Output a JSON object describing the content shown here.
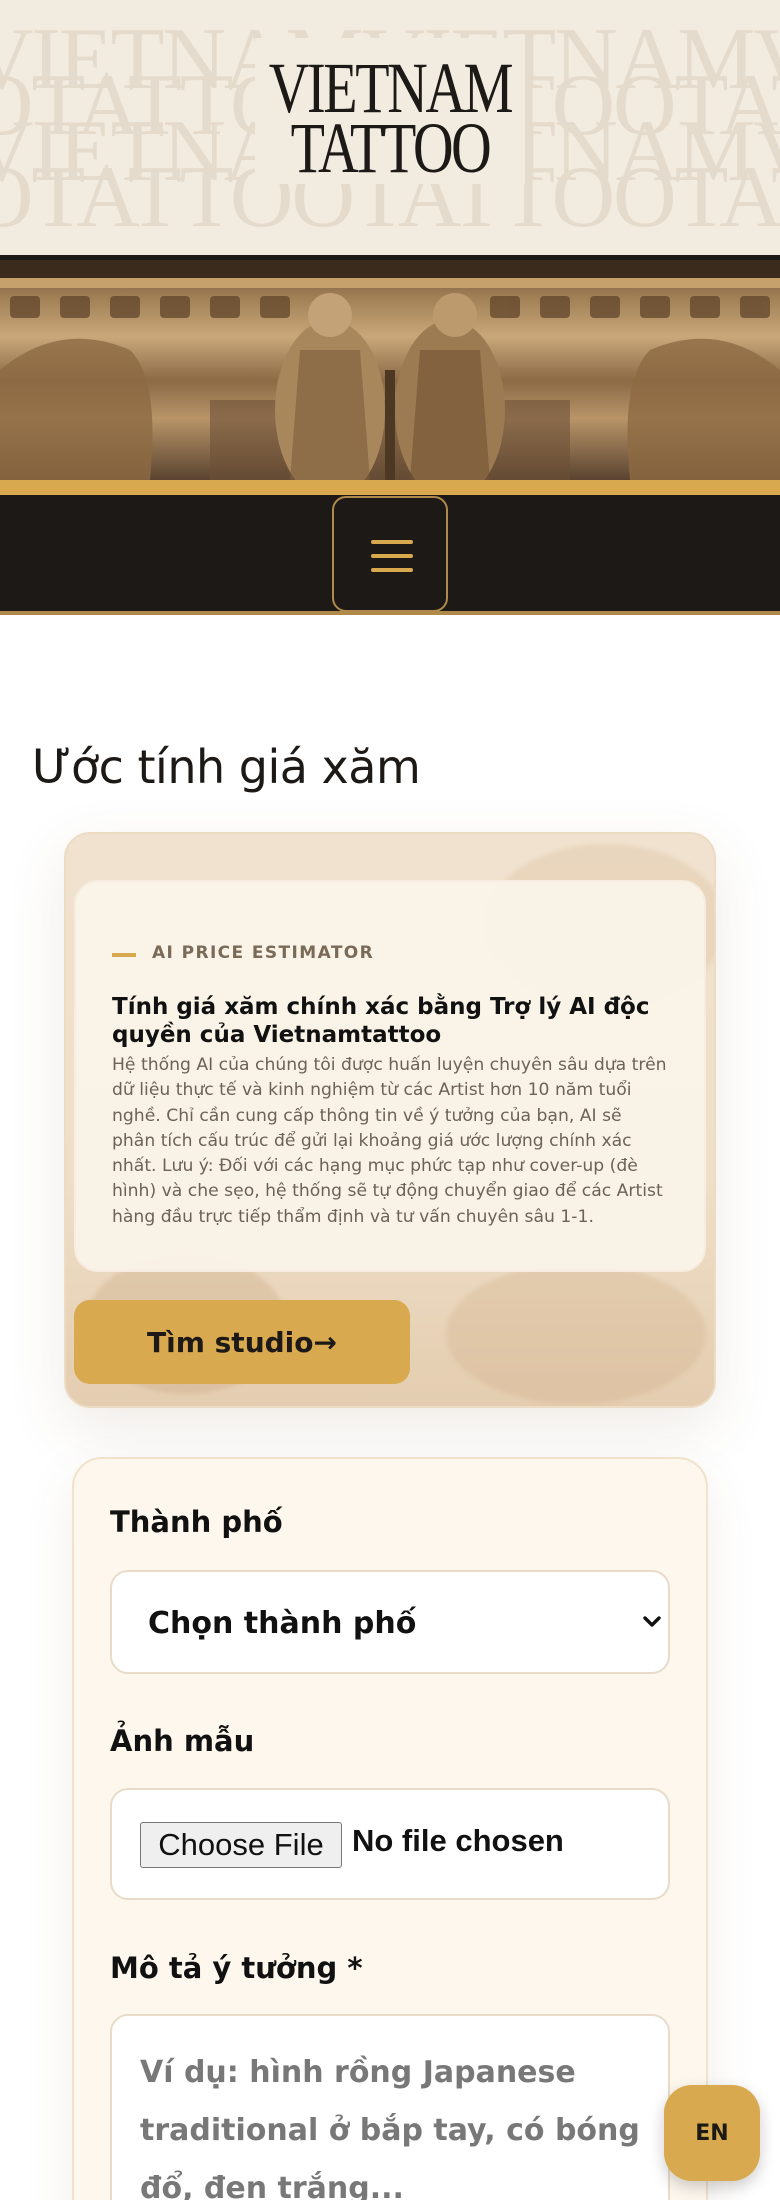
{
  "brand": {
    "logo_line1": "VIETNAM",
    "logo_line2": "TATTOO",
    "pattern_words": [
      "VIETNAMVIETNAMVIETNAMVIETNAMV",
      "OTATTOOTATTOOTATTOOTATT"
    ]
  },
  "nav": {
    "menu_icon": "hamburger-icon"
  },
  "page": {
    "title": "Ước tính giá xăm"
  },
  "estimator": {
    "kicker": "AI PRICE ESTIMATOR",
    "heading": "Tính giá xăm chính xác bằng Trợ lý AI độc quyền của Vietnamtattoo",
    "body": "Hệ thống AI của chúng tôi được huấn luyện chuyên sâu dựa trên dữ liệu thực tế và kinh nghiệm từ các Artist hơn 10 năm tuổi nghề. Chỉ cần cung cấp thông tin về ý tưởng của bạn, AI sẽ phân tích cấu trúc để gửi lại khoảng giá ước lượng chính xác nhất. Lưu ý: Đối với các hạng mục phức tạp như cover-up (đè hình) và che sẹo, hệ thống sẽ tự động chuyển giao để các Artist hàng đầu trực tiếp thẩm định và tư vấn chuyên sâu 1-1.",
    "cta_label": "Tìm studio→"
  },
  "form": {
    "city_label": "Thành phố",
    "city_value": "Chọn thành phố",
    "image_label": "Ảnh mẫu",
    "file_button": "Choose File",
    "file_status": "No file chosen",
    "idea_label": "Mô tả ý tưởng *",
    "idea_placeholder": "Ví dụ: hình rồng Japanese traditional ở bắp tay, có bóng đổ, đen trắng..."
  },
  "language": {
    "label": "EN"
  },
  "colors": {
    "gold": "#d8a94e",
    "dark": "#1d1917",
    "cream": "#f2ebe0"
  }
}
